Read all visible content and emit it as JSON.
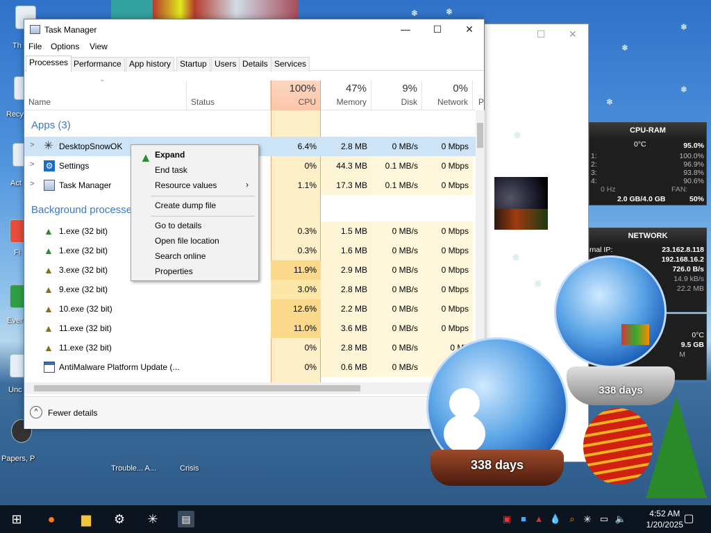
{
  "desktop": {
    "labels": [
      "Th",
      "Recy",
      "Act",
      "Fi",
      "Ever",
      "Unc",
      "Papers, P",
      "Trouble... A...",
      "Crisis"
    ]
  },
  "taskmanager": {
    "title": "Task Manager",
    "menu": [
      "File",
      "Options",
      "View"
    ],
    "tabs": [
      "Processes",
      "Performance",
      "App history",
      "Startup",
      "Users",
      "Details",
      "Services"
    ],
    "header": {
      "name": "Name",
      "status": "Status",
      "cpu_pct": "100%",
      "cpu": "CPU",
      "mem_pct": "47%",
      "mem": "Memory",
      "disk_pct": "9%",
      "disk": "Disk",
      "net_pct": "0%",
      "net": "Network",
      "extra": "P"
    },
    "groups": {
      "apps": "Apps (3)",
      "background": "Background processe"
    },
    "apps": [
      {
        "name": "DesktopSnowOK",
        "cpu": "6.4%",
        "mem": "2.8 MB",
        "disk": "0 MB/s",
        "net": "0 Mbps"
      },
      {
        "name": "Settings",
        "cpu": "0%",
        "mem": "44.3 MB",
        "disk": "0.1 MB/s",
        "net": "0 Mbps"
      },
      {
        "name": "Task Manager",
        "cpu": "1.1%",
        "mem": "17.3 MB",
        "disk": "0.1 MB/s",
        "net": "0 Mbps"
      }
    ],
    "background": [
      {
        "name": "1.exe (32 bit)",
        "cpu": "0.3%",
        "mem": "1.5 MB",
        "disk": "0 MB/s",
        "net": "0 Mbps"
      },
      {
        "name": "1.exe (32 bit)",
        "cpu": "0.3%",
        "mem": "1.6 MB",
        "disk": "0 MB/s",
        "net": "0 Mbps"
      },
      {
        "name": "3.exe (32 bit)",
        "cpu": "11.9%",
        "mem": "2.9 MB",
        "disk": "0 MB/s",
        "net": "0 Mbps"
      },
      {
        "name": "9.exe (32 bit)",
        "cpu": "3.0%",
        "mem": "2.8 MB",
        "disk": "0 MB/s",
        "net": "0 Mbps"
      },
      {
        "name": "10.exe (32 bit)",
        "cpu": "12.6%",
        "mem": "2.2 MB",
        "disk": "0 MB/s",
        "net": "0 Mbps"
      },
      {
        "name": "11.exe (32 bit)",
        "cpu": "11.0%",
        "mem": "3.6 MB",
        "disk": "0 MB/s",
        "net": "0 Mbps"
      },
      {
        "name": "11.exe (32 bit)",
        "cpu": "0%",
        "mem": "2.8 MB",
        "disk": "0 MB/s",
        "net": "0 Mb"
      },
      {
        "name": "AntiMalware Platform Update (...",
        "cpu": "0%",
        "mem": "0.6 MB",
        "disk": "0 MB/s",
        "net": "0 M"
      }
    ],
    "fewer_details": "Fewer details"
  },
  "context_menu": {
    "items": [
      "Expand",
      "End task",
      "Resource values",
      "Create dump file",
      "Go to details",
      "Open file location",
      "Search online",
      "Properties"
    ]
  },
  "gadgets": {
    "cpu_ram": {
      "title": "CPU-RAM",
      "temp": "0°C",
      "total": "95.0%",
      "cores": [
        {
          "label": "1:",
          "value": "100.0%"
        },
        {
          "label": "2:",
          "value": "96.9%"
        },
        {
          "label": "3:",
          "value": "93.8%"
        },
        {
          "label": "4:",
          "value": "90.6%"
        }
      ],
      "freq": "0 Hz",
      "fan": "FAN:",
      "ram": "2.0 GB/4.0 GB",
      "ram_pct": "50%"
    },
    "network": {
      "title": "NETWORK",
      "ext_label": "rnal IP:",
      "ext_ip": "23.162.8.118",
      "int_ip": "192.168.16.2",
      "rate1": "726.0 B/s",
      "rate2": "14.9 kB/s",
      "rate3": "22.2 MB"
    },
    "drive": {
      "temp": "0°C",
      "size": "9.5 GB",
      "extra": "M"
    }
  },
  "globes": {
    "front": "338 days",
    "back": "338 days"
  },
  "taskbar": {
    "time": "4:52 AM",
    "date": "1/20/2025"
  },
  "colors": {
    "accent": "#3b79c6",
    "cpu_header": "#fbc5a8",
    "selection": "#cde4f7",
    "taskbar": "#0c1420"
  }
}
